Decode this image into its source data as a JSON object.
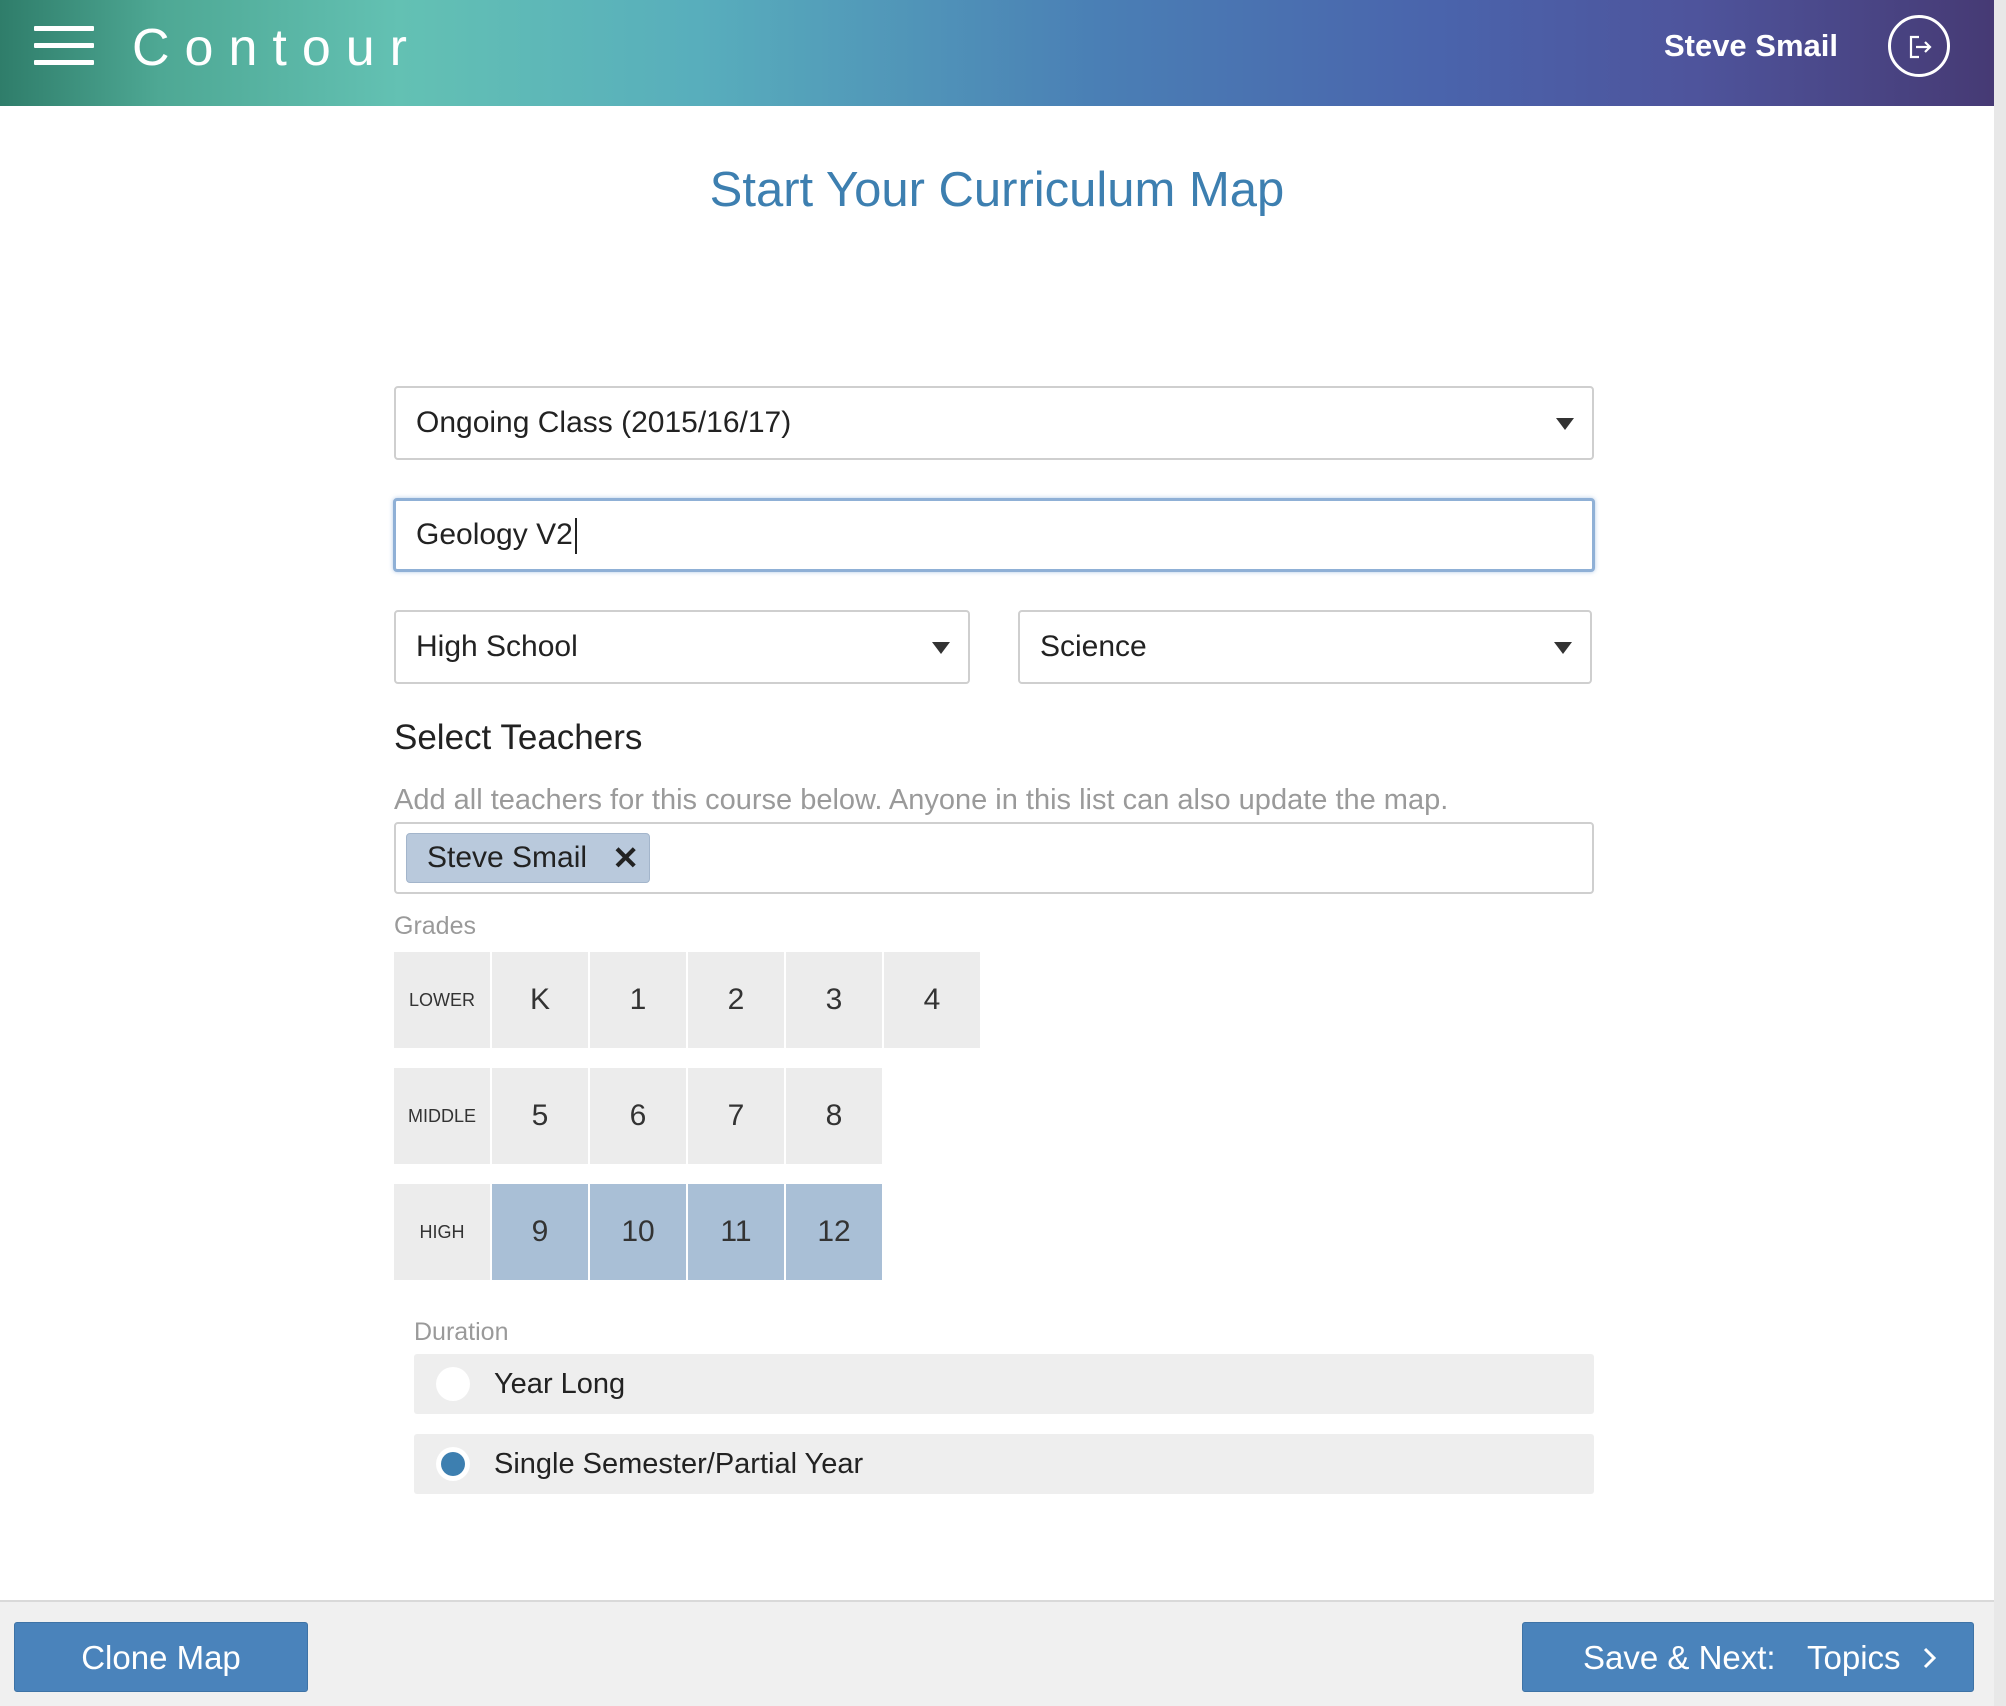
{
  "header": {
    "app_name": "Contour",
    "user_name": "Steve Smail",
    "menu_icon": "hamburger-menu-icon",
    "logout_icon": "logout-icon"
  },
  "page": {
    "title": "Start Your Curriculum Map"
  },
  "form": {
    "class_type": {
      "selected": "Ongoing Class (2015/16/17)"
    },
    "map_name": {
      "value": "Geology V2"
    },
    "school_level": {
      "selected": "High School"
    },
    "subject": {
      "selected": "Science"
    }
  },
  "teachers": {
    "title": "Select Teachers",
    "help": "Add all teachers for this course below. Anyone in this list can also update the map.",
    "selected": [
      "Steve Smail"
    ],
    "remove_symbol": "✕"
  },
  "grades": {
    "label": "Grades",
    "rows": [
      {
        "label": "LOWER",
        "grades": [
          "K",
          "1",
          "2",
          "3",
          "4"
        ],
        "selected": []
      },
      {
        "label": "MIDDLE",
        "grades": [
          "5",
          "6",
          "7",
          "8"
        ],
        "selected": []
      },
      {
        "label": "HIGH",
        "grades": [
          "9",
          "10",
          "11",
          "12"
        ],
        "selected": [
          "9",
          "10",
          "11",
          "12"
        ]
      }
    ]
  },
  "duration": {
    "label": "Duration",
    "options": [
      "Year Long",
      "Single Semester/Partial Year"
    ],
    "selected": "Single Semester/Partial Year"
  },
  "footer": {
    "clone_label": "Clone Map",
    "next_label": "Save & Next:",
    "next_target": "Topics",
    "next_icon": "chevron-right-icon"
  },
  "colors": {
    "accent": "#4a83bb",
    "title": "#3d7fb0",
    "grade_selected": "#a9bfd6"
  }
}
